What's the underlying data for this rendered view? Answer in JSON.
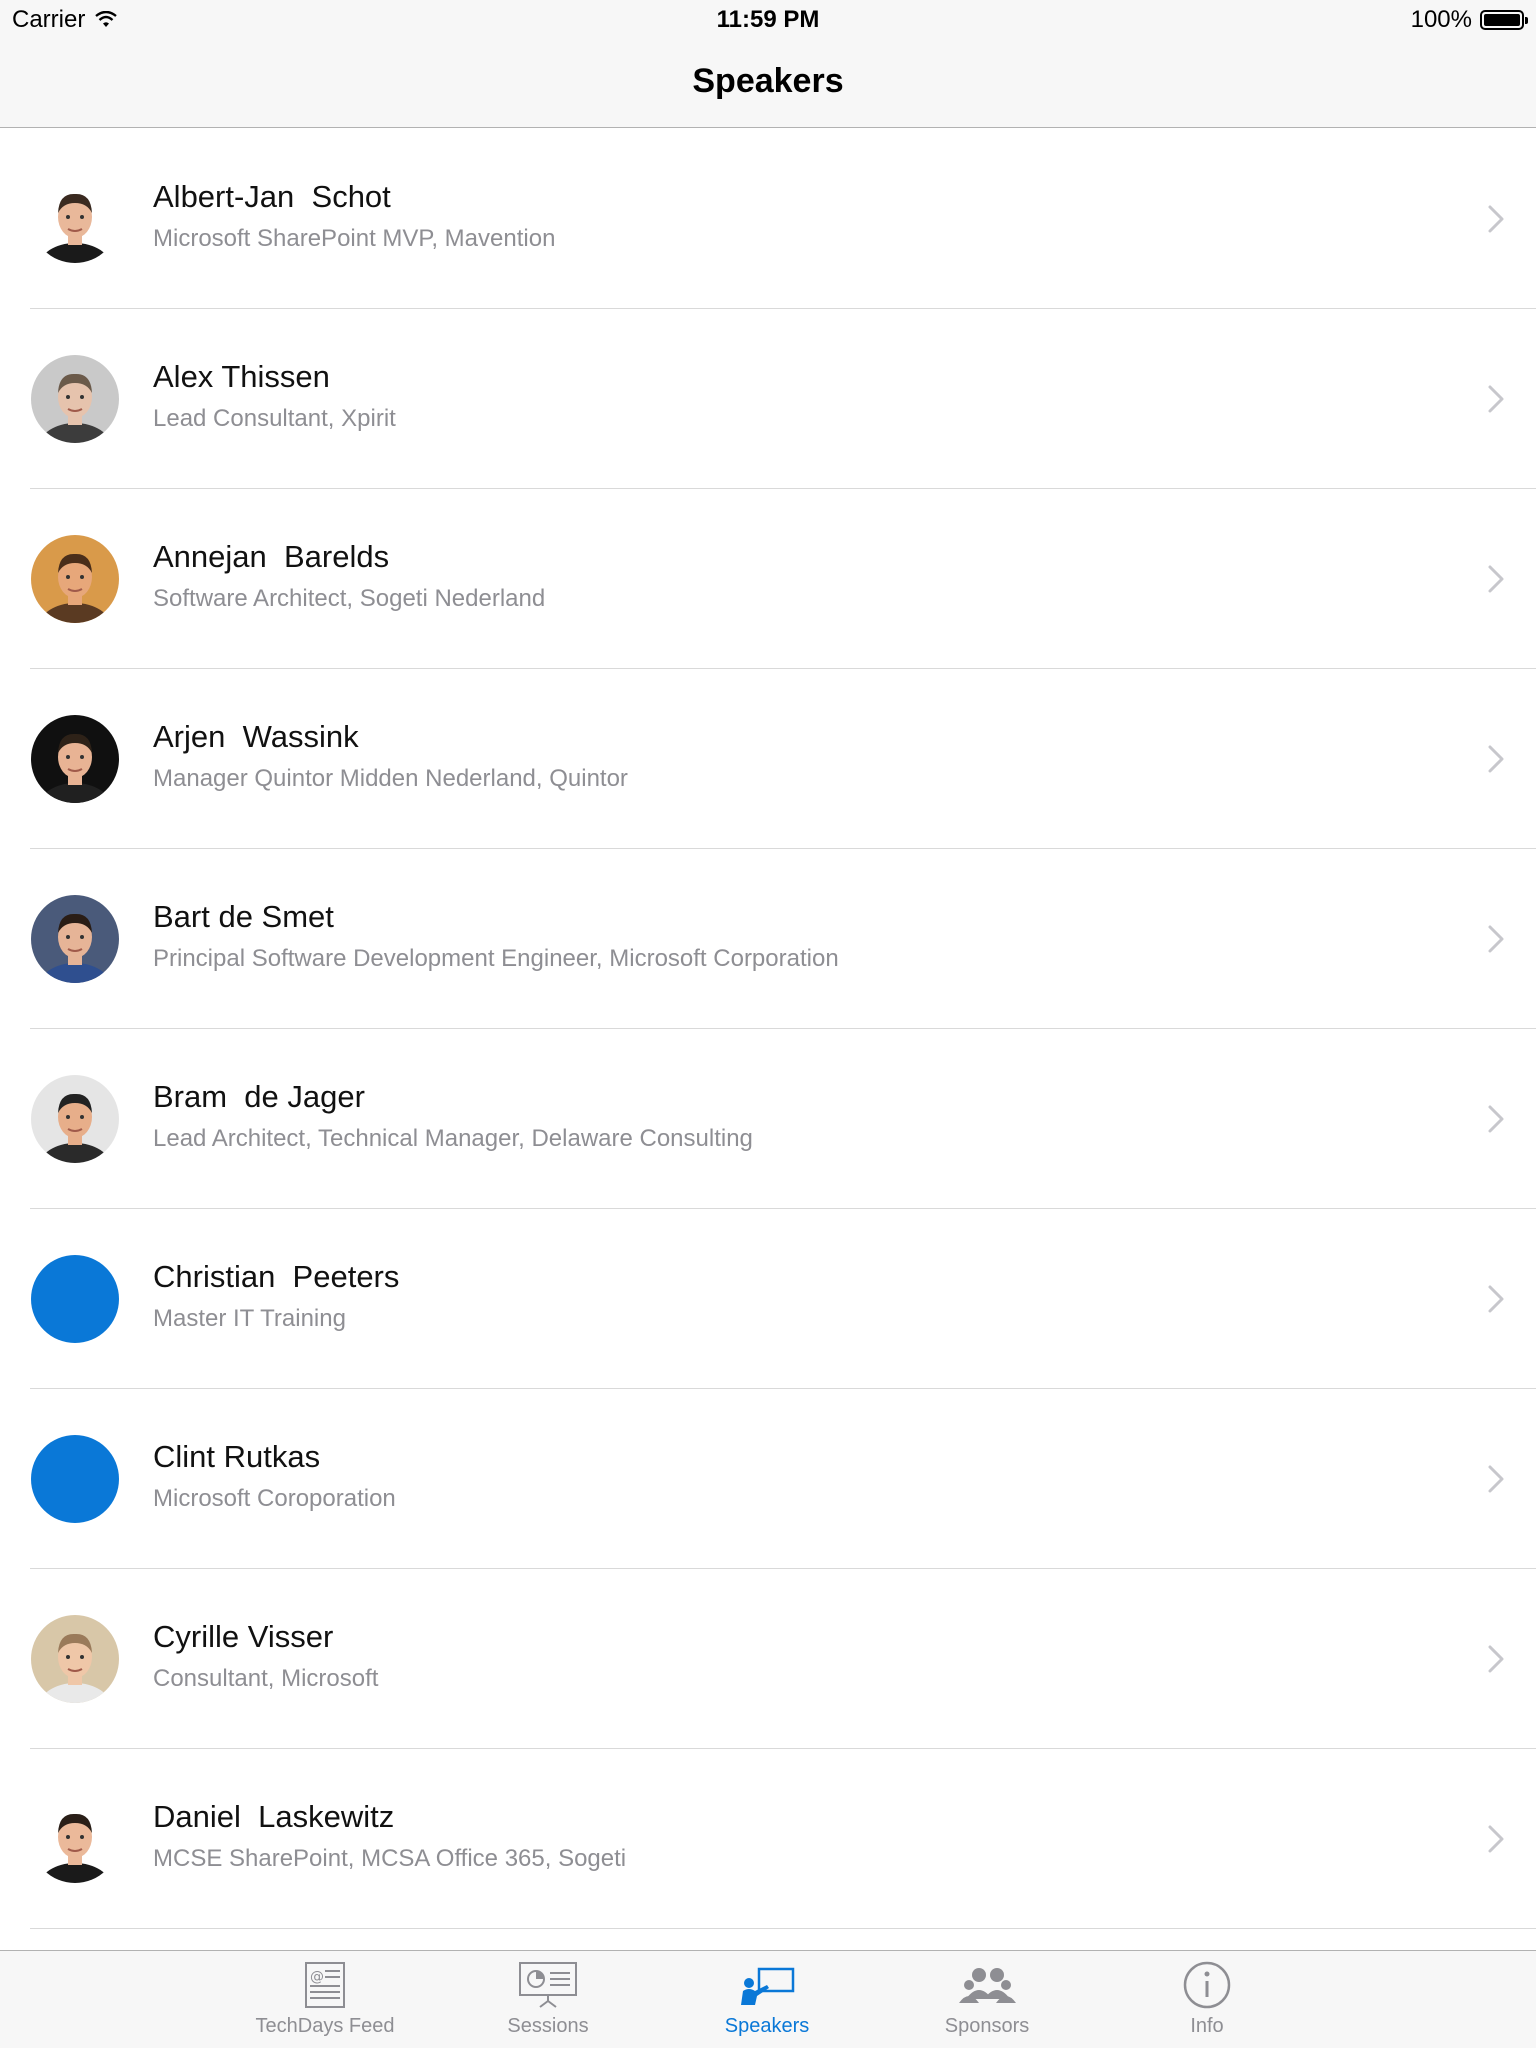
{
  "status_bar": {
    "carrier": "Carrier",
    "time": "11:59 PM",
    "battery": "100%"
  },
  "nav": {
    "title": "Speakers"
  },
  "speakers": [
    {
      "name": "Albert-Jan  Schot",
      "subtitle": "Microsoft SharePoint MVP, Mavention",
      "avatar": "photo"
    },
    {
      "name": "Alex Thissen",
      "subtitle": "Lead Consultant, Xpirit",
      "avatar": "photo"
    },
    {
      "name": "Annejan  Barelds",
      "subtitle": "Software Architect, Sogeti Nederland",
      "avatar": "photo"
    },
    {
      "name": "Arjen  Wassink",
      "subtitle": "Manager Quintor Midden Nederland, Quintor",
      "avatar": "photo"
    },
    {
      "name": "Bart de Smet",
      "subtitle": "Principal Software Development Engineer, Microsoft Corporation",
      "avatar": "photo"
    },
    {
      "name": "Bram  de Jager",
      "subtitle": "Lead Architect, Technical Manager, Delaware Consulting",
      "avatar": "photo"
    },
    {
      "name": "Christian  Peeters",
      "subtitle": "Master IT Training",
      "avatar": "placeholder"
    },
    {
      "name": "Clint Rutkas",
      "subtitle": "Microsoft Coroporation",
      "avatar": "placeholder"
    },
    {
      "name": "Cyrille Visser",
      "subtitle": "Consultant, Microsoft",
      "avatar": "photo"
    },
    {
      "name": "Daniel  Laskewitz",
      "subtitle": "MCSE SharePoint, MCSA Office 365, Sogeti",
      "avatar": "photo"
    }
  ],
  "tabs": [
    {
      "label": "TechDays Feed",
      "icon": "newspaper-icon",
      "active": false
    },
    {
      "label": "Sessions",
      "icon": "presentation-icon",
      "active": false
    },
    {
      "label": "Speakers",
      "icon": "speaker-icon",
      "active": true
    },
    {
      "label": "Sponsors",
      "icon": "group-icon",
      "active": false
    },
    {
      "label": "Info",
      "icon": "info-icon",
      "active": false
    }
  ],
  "colors": {
    "accent": "#0a78d7",
    "placeholder_avatar": "#0a78d7",
    "secondary_text": "#8e8e93",
    "bar_background": "#f7f7f7"
  }
}
